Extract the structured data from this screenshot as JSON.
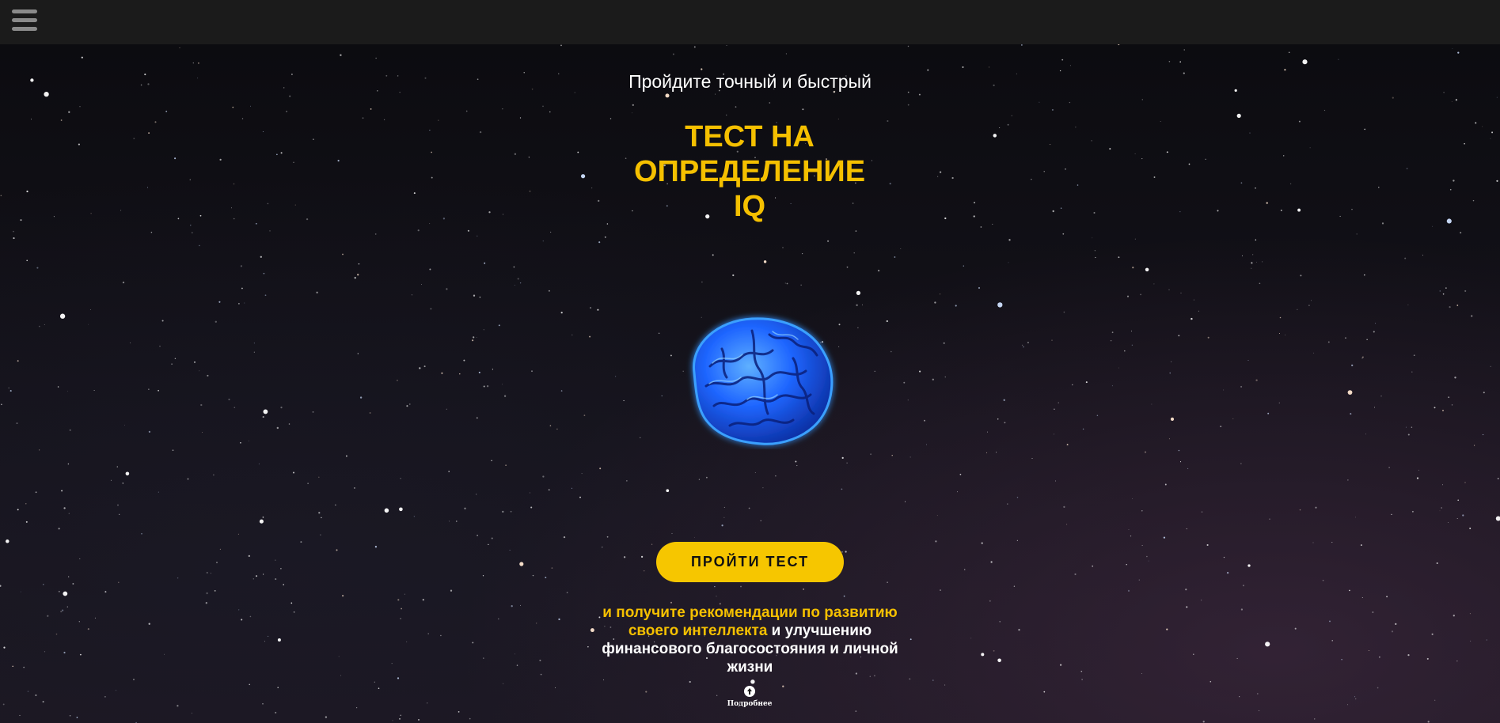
{
  "header": {
    "menu_icon": "hamburger-menu-icon"
  },
  "hero": {
    "subtitle": "Пройдите точный и быстрый",
    "title_line1": "ТЕСТ НА",
    "title_line2": "ОПРЕДЕЛЕНИЕ",
    "title_line3": "IQ",
    "image": "brain-illustration",
    "cta_label": "ПРОЙТИ ТЕСТ",
    "description_accent": "и получите рекомендации по развитию своего интеллекта",
    "description_rest": " и улучшению финансового благосостояния и личной жизни",
    "more_icon": "arrow-up-circle-icon",
    "more_label": "Подробнее"
  },
  "colors": {
    "topbar": "#1b1b1b",
    "accent_yellow": "#f5c000",
    "button": "#f6c600",
    "text": "#ffffff",
    "brain": "#1e63ff"
  }
}
